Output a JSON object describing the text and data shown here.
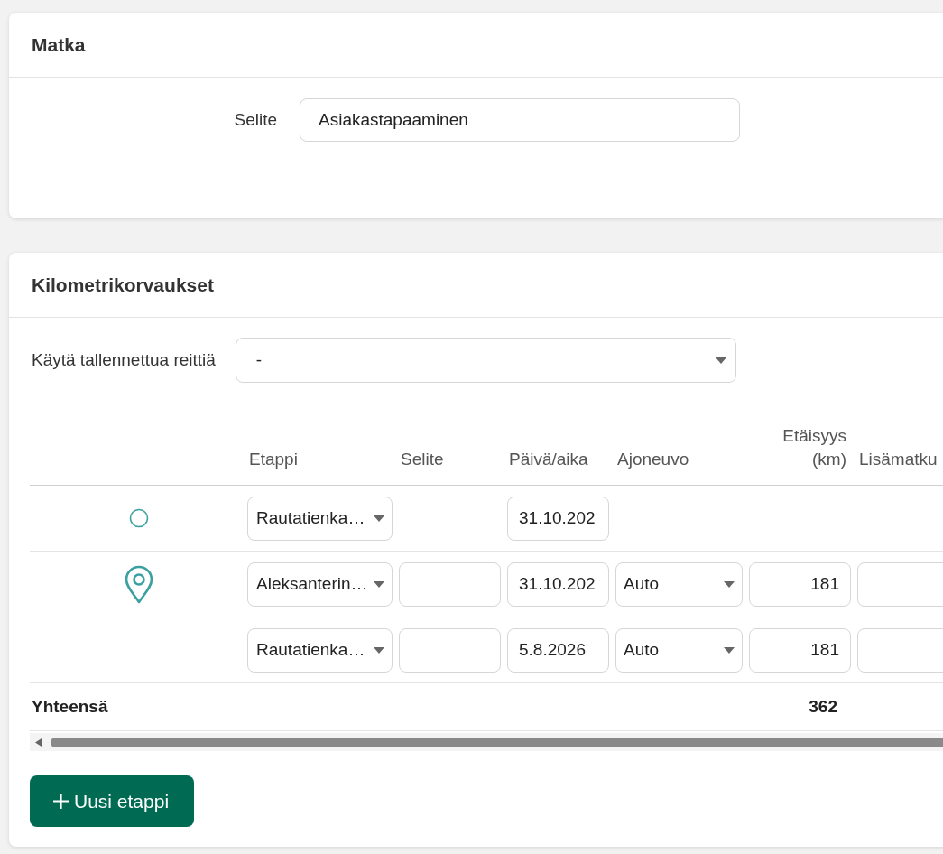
{
  "trip_card": {
    "title": "Matka",
    "description_label": "Selite",
    "description_value": "Asiakastapaaminen"
  },
  "mileage_card": {
    "title": "Kilometrikorvaukset",
    "route_label": "Käytä tallennettua reittiä",
    "route_value": "-",
    "columns": [
      "Etappi",
      "Selite",
      "Päivä/aika",
      "Ajoneuvo",
      "Etäisyys (km)",
      "Lisämatku"
    ],
    "rows": [
      {
        "kind": "start",
        "stage": "Rautatienka…",
        "datetime": "31.10.202"
      },
      {
        "kind": "destination",
        "stage": "Aleksanterin…",
        "datetime": "31.10.202",
        "vehicle": "Auto",
        "distance": "181"
      },
      {
        "kind": "leg",
        "stage": "Rautatienka…",
        "datetime": "5.8.2026",
        "vehicle": "Auto",
        "distance": "181"
      }
    ],
    "total_label": "Yhteensä",
    "total_distance": "362",
    "add_button": "Uusi etappi"
  }
}
